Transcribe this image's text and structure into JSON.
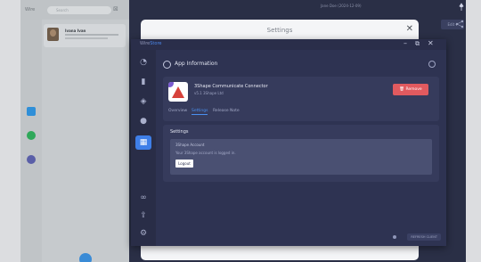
{
  "left_panel": {
    "brand": "Wire",
    "search_placeholder": "Search",
    "close_glyph": "⊠",
    "conversation": {
      "name": "Ivana Ivan"
    }
  },
  "background": {
    "status_text": "Jane Doe (2024-12-09)",
    "top_button": "Edit ▾",
    "settings_dialog_title": "Settings",
    "close_glyph": "✕"
  },
  "window": {
    "brand_prefix": "Wire",
    "brand_suffix": "Store",
    "controls": {
      "minimize": "–",
      "maximize": "⧉",
      "close": "✕"
    },
    "sidebar_icons": [
      "pie-chart-icon",
      "book-icon",
      "layers-icon",
      "location-pin-icon",
      "apps-grid-icon",
      "link-icon",
      "upload-icon",
      "gear-icon"
    ],
    "active_sidebar_index": 4
  },
  "app_info": {
    "header": "App Information",
    "app_name": "3Shape Communicate Connector",
    "app_version": "v5.1 3Shape Ltd",
    "remove_label": "Remove",
    "tabs": [
      "Overview",
      "Settings",
      "Release Note"
    ],
    "active_tab": 1
  },
  "settings": {
    "title": "Settings",
    "box_title": "3Shape Account",
    "box_desc": "Your 3Shape account is logged in.",
    "logout_label": "Logout"
  },
  "footer": {
    "button_label": "REFRESH CLIENT"
  },
  "colors": {
    "accent": "#3f7fe8",
    "danger": "#e15a5f",
    "panel": "#2e3352"
  }
}
